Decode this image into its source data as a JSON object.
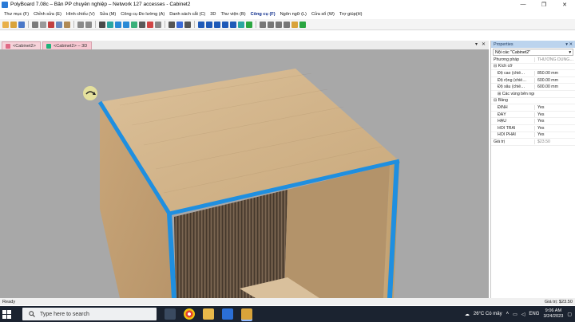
{
  "window": {
    "title": "PolyBoard 7.08c – Bản PP chuyên nghiệp – Network 127 accesses - Cabinet2",
    "minimize": "—",
    "maximize": "❐",
    "close": "✕"
  },
  "menu": [
    "Thư mục (F)",
    "Chỉnh sửa (E)",
    "Hình chiếu (V)",
    "Sửa (M)",
    "Công cụ Đo lường (A)",
    "Danh sách cắt (C)",
    "3D",
    "Thư viện (B)",
    "Công cụ (F)",
    "Ngôn ngữ (L)",
    "Cửa sổ (W)",
    "Trợ giúp(H)"
  ],
  "tabs": [
    {
      "label": "<Cabinet2>",
      "active": false
    },
    {
      "label": "<Cabinet2> – 3D",
      "active": true
    }
  ],
  "tab_controls": {
    "dropdown": "▾",
    "close": "✕"
  },
  "properties": {
    "title": "Properties",
    "pin": "▾ ✕",
    "selector": "Nội các \"Cabinet2\"",
    "selector_arrow": "▾",
    "rows": [
      {
        "key": "Phương pháp",
        "value": "THƯỜNG DÙNG…",
        "muted": true,
        "level": 0
      },
      {
        "key": "⊟ Kích cỡ",
        "value": "",
        "level": 0,
        "group": true
      },
      {
        "key": "Độ cao (chiề…",
        "value": "850.00 mm",
        "level": 1
      },
      {
        "key": "Độ rộng (chiề…",
        "value": "600.00 mm",
        "level": 1
      },
      {
        "key": "Độ sâu (chiề…",
        "value": "600.00 mm",
        "level": 1
      },
      {
        "key": "⊞ Các vùng bên ngoài",
        "value": "",
        "level": 1,
        "group": true
      },
      {
        "key": "⊟ Bảng",
        "value": "",
        "level": 0,
        "group": true
      },
      {
        "key": "ĐỈNH",
        "value": "Yes",
        "level": 1
      },
      {
        "key": "ĐÁY",
        "value": "Yes",
        "level": 1
      },
      {
        "key": "HẬU",
        "value": "Yes",
        "level": 1
      },
      {
        "key": "HỒI TRÁI",
        "value": "Yes",
        "level": 1
      },
      {
        "key": "HỒI PHẢI",
        "value": "Yes",
        "level": 1
      },
      {
        "key": "Giá trị",
        "value": "$23.50",
        "muted": true,
        "level": 0
      }
    ]
  },
  "status": {
    "left": "Ready",
    "right": "Giá trị: $23.50"
  },
  "taskbar": {
    "search_placeholder": "Type here to search",
    "weather": "26°C  Có mây",
    "lang": "ENG",
    "time": "9:06 AM",
    "date": "3/24/2023"
  },
  "colors": {
    "viewport_bg": "#a8a8a8",
    "edge_band": "#1f8fe0",
    "wood_light": "#d6b68e",
    "wood_dark": "#5b4a3a"
  }
}
